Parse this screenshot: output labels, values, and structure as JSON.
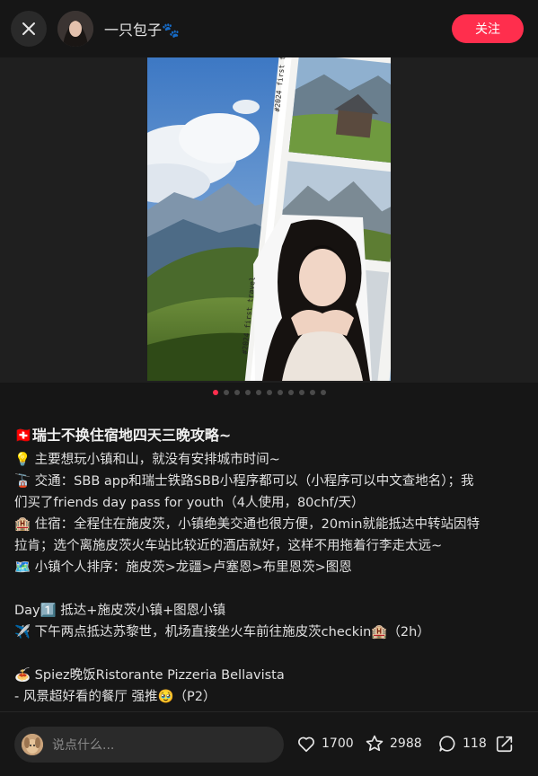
{
  "header": {
    "author_name": "一只包子🐾",
    "follow_label": "关注"
  },
  "carousel": {
    "film_label_1": "#2024 first travel",
    "film_label_2": "#2024 first travel",
    "total_dots": 11,
    "active_index": 0
  },
  "post": {
    "title": "🇨🇭瑞士不换住宿地四天三晚攻略~",
    "lines": [
      "💡 主要想玩小镇和山，就没有安排城市时间~",
      "🚡 交通：SBB app和瑞士铁路SBB小程序都可以（小程序可以中文查地名）；我",
      "们买了friends day pass for youth（4人使用，80chf/天）",
      "🏨 住宿：全程住在施皮茨，小镇绝美交通也很方便，20min就能抵达中转站因特",
      "拉肯；选个离施皮茨火车站比较近的酒店就好，这样不用拖着行李走太远~",
      "🗺️ 小镇个人排序：施皮茨>龙疆>卢塞恩>布里恩茨>图恩",
      "",
      "Day1️⃣ 抵达+施皮茨小镇+图恩小镇",
      "✈️ 下午两点抵达苏黎世，机场直接坐火车前往施皮茨checkin🏨（2h）",
      "",
      "🍝 Spiez晚饭Ristorante Pizzeria Bellavista",
      "- 风景超好看的餐厅 强推🥹（P2）"
    ]
  },
  "bottom_bar": {
    "comment_placeholder": "说点什么...",
    "likes": "1700",
    "favorites": "2988",
    "comments": "118"
  },
  "colors": {
    "accent": "#ff2e4d",
    "background": "#161616"
  }
}
